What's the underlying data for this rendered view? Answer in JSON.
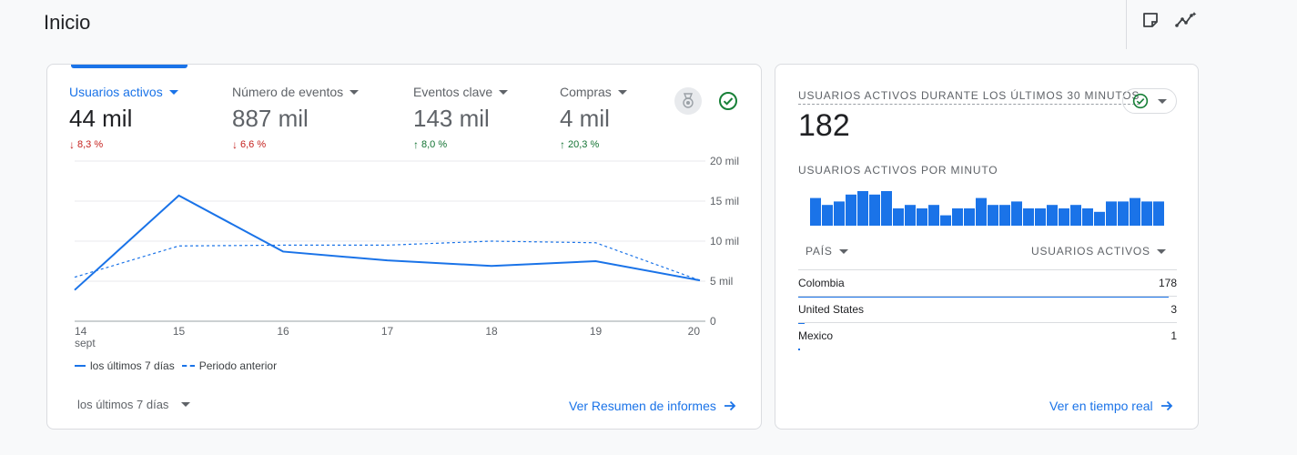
{
  "page": {
    "title": "Inicio"
  },
  "toolbar": {
    "icons": [
      "notes-icon",
      "insights-icon"
    ]
  },
  "overview": {
    "metrics": [
      {
        "label": "Usuarios activos",
        "value": "44 mil",
        "delta": "8,3 %",
        "direction": "down",
        "active": true
      },
      {
        "label": "Número de eventos",
        "value": "887 mil",
        "delta": "6,6 %",
        "direction": "down",
        "active": false
      },
      {
        "label": "Eventos clave",
        "value": "143 mil",
        "delta": "8,0 %",
        "direction": "up",
        "active": false
      },
      {
        "label": "Compras",
        "value": "4 mil",
        "delta": "20,3 %",
        "direction": "up",
        "active": false
      }
    ],
    "legend": {
      "current": "los últimos 7 días",
      "previous": "Periodo anterior"
    },
    "date_range": "los últimos 7 días",
    "link": "Ver Resumen de informes"
  },
  "chart_data": {
    "type": "line",
    "categories": [
      "14",
      "15",
      "16",
      "17",
      "18",
      "19",
      "20"
    ],
    "x_sublabel": "sept",
    "y_tick_labels": [
      "0",
      "5 mil",
      "10 mil",
      "15 mil",
      "20 mil"
    ],
    "y_ticks": [
      0,
      5000,
      10000,
      15000,
      20000
    ],
    "ylim": [
      0,
      20000
    ],
    "grid": true,
    "legend_position": "bottom-left",
    "series": [
      {
        "name": "los últimos 7 días",
        "style": "solid",
        "values": [
          3900,
          15700,
          8700,
          7600,
          6900,
          7500,
          5100
        ]
      },
      {
        "name": "Periodo anterior",
        "style": "dashed",
        "values": [
          5500,
          9400,
          9500,
          9500,
          10000,
          9800,
          5100
        ]
      }
    ]
  },
  "realtime": {
    "title": "USUARIOS ACTIVOS DURANTE LOS ÚLTIMOS 30 MINUTOS",
    "value": "182",
    "subtitle": "USUARIOS ACTIVOS POR MINUTO",
    "per_minute": [
      8,
      6,
      7,
      9,
      10,
      9,
      10,
      5,
      6,
      5,
      6,
      3,
      5,
      5,
      8,
      6,
      6,
      7,
      5,
      5,
      6,
      5,
      6,
      5,
      4,
      7,
      7,
      8,
      7,
      7
    ],
    "col_country": "PAÍS",
    "col_users": "USUARIOS ACTIVOS",
    "rows": [
      {
        "country": "Colombia",
        "users": "178",
        "share": 0.978
      },
      {
        "country": "United States",
        "users": "3",
        "share": 0.016
      },
      {
        "country": "Mexico",
        "users": "1",
        "share": 0.006
      }
    ],
    "link": "Ver en tiempo real"
  },
  "colors": {
    "accent": "#1a73e8",
    "down": "#c5221f",
    "up": "#137333",
    "check": "#188038"
  }
}
